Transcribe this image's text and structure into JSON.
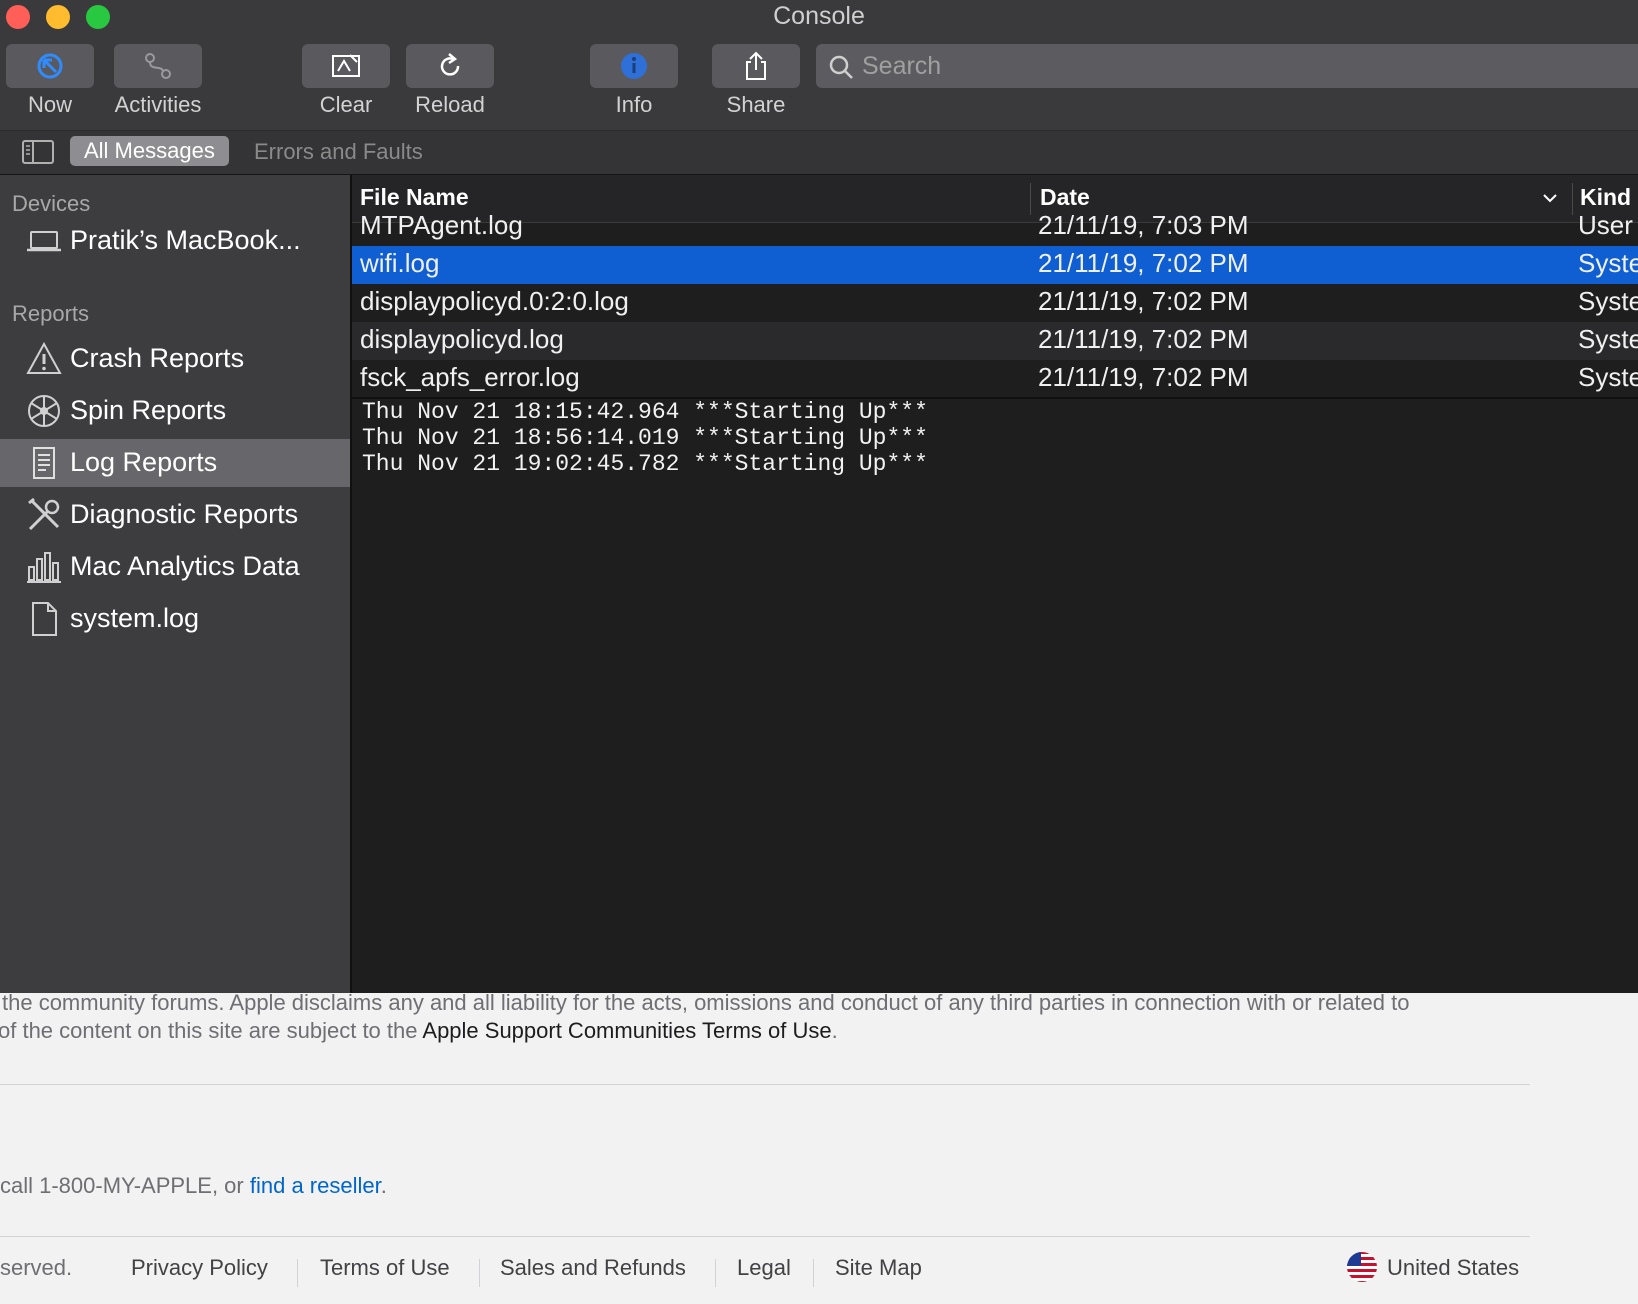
{
  "window": {
    "title": "Console",
    "traffic_lights": {
      "close": "#ff5f57",
      "minimize": "#febc2e",
      "zoom": "#28c840"
    }
  },
  "toolbar": {
    "now_label": "Now",
    "activities_label": "Activities",
    "clear_label": "Clear",
    "reload_label": "Reload",
    "info_label": "Info",
    "share_label": "Share",
    "search_placeholder": "Search"
  },
  "filter": {
    "all_messages": "All Messages",
    "errors_faults": "Errors and Faults"
  },
  "sidebar": {
    "devices_header": "Devices",
    "device_name": "Pratik’s MacBook...",
    "reports_header": "Reports",
    "items": [
      {
        "label": "Crash Reports",
        "icon": "warning-triangle-icon"
      },
      {
        "label": "Spin Reports",
        "icon": "spin-wheel-icon"
      },
      {
        "label": "Log Reports",
        "icon": "document-list-icon",
        "selected": true
      },
      {
        "label": "Diagnostic Reports",
        "icon": "tools-icon"
      },
      {
        "label": "Mac Analytics Data",
        "icon": "bar-chart-icon"
      },
      {
        "label": "system.log",
        "icon": "file-icon"
      }
    ]
  },
  "table": {
    "columns": [
      "File Name",
      "Date",
      "Kind"
    ],
    "rows": [
      {
        "name": "MTPAgent.log",
        "date": "21/11/19, 7:03 PM",
        "kind": "User"
      },
      {
        "name": "wifi.log",
        "date": "21/11/19, 7:02 PM",
        "kind": "Syste"
      },
      {
        "name": "displaypolicyd.0:2:0.log",
        "date": "21/11/19, 7:02 PM",
        "kind": "Syste"
      },
      {
        "name": "displaypolicyd.log",
        "date": "21/11/19, 7:02 PM",
        "kind": "Syste"
      },
      {
        "name": "fsck_apfs_error.log",
        "date": "21/11/19, 7:02 PM",
        "kind": "Syste"
      }
    ],
    "selected_row": 1
  },
  "log": {
    "lines": [
      "Thu Nov 21 18:15:42.964 ***Starting Up***",
      "Thu Nov 21 18:56:14.019 ***Starting Up***",
      "Thu Nov 21 19:02:45.782 ***Starting Up***"
    ]
  },
  "webpage": {
    "disclaimer_line1": "the community forums. Apple disclaims any and all liability for the acts, omissions and conduct of any third parties in connection with or related to",
    "disclaimer_line2_prefix": "of the content on this site are subject to the ",
    "disclaimer_line2_link": "Apple Support Communities Terms of Use",
    "disclaimer_line2_suffix": ".",
    "call_prefix": "call 1-800-MY-APPLE, or ",
    "call_link": "find a reseller",
    "call_suffix": ".",
    "copyright_fragment": "served.",
    "footer_links": [
      "Privacy Policy",
      "Terms of Use",
      "Sales and Refunds",
      "Legal",
      "Site Map"
    ],
    "country": "United States"
  }
}
